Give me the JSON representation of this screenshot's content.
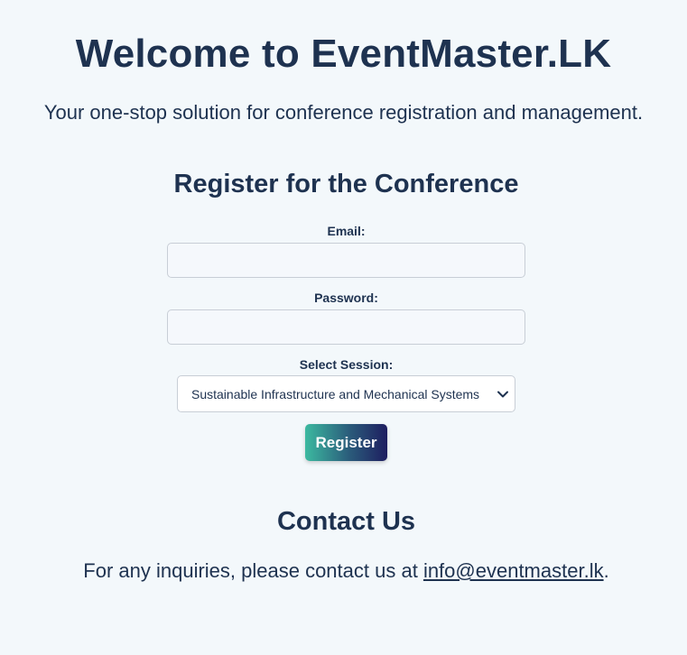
{
  "header": {
    "title": "Welcome to EventMaster.LK",
    "subtitle": "Your one-stop solution for conference registration and management."
  },
  "registration": {
    "heading": "Register for the Conference",
    "email_label": "Email:",
    "email_value": "",
    "password_label": "Password:",
    "password_value": "",
    "session_label": "Select Session:",
    "session_selected": "Sustainable Infrastructure and Mechanical Systems",
    "register_button": "Register"
  },
  "contact": {
    "heading": "Contact Us",
    "text_before": "For any inquiries, please contact us at ",
    "email_link": "info@eventmaster.lk",
    "text_after": "."
  },
  "icons": {
    "session_dropdown": "chevron-down-icon"
  },
  "colors": {
    "background": "#f3f8fb",
    "text": "#1e3250",
    "button_gradient_start": "#3cb9a0",
    "button_gradient_end": "#1e1e60"
  }
}
